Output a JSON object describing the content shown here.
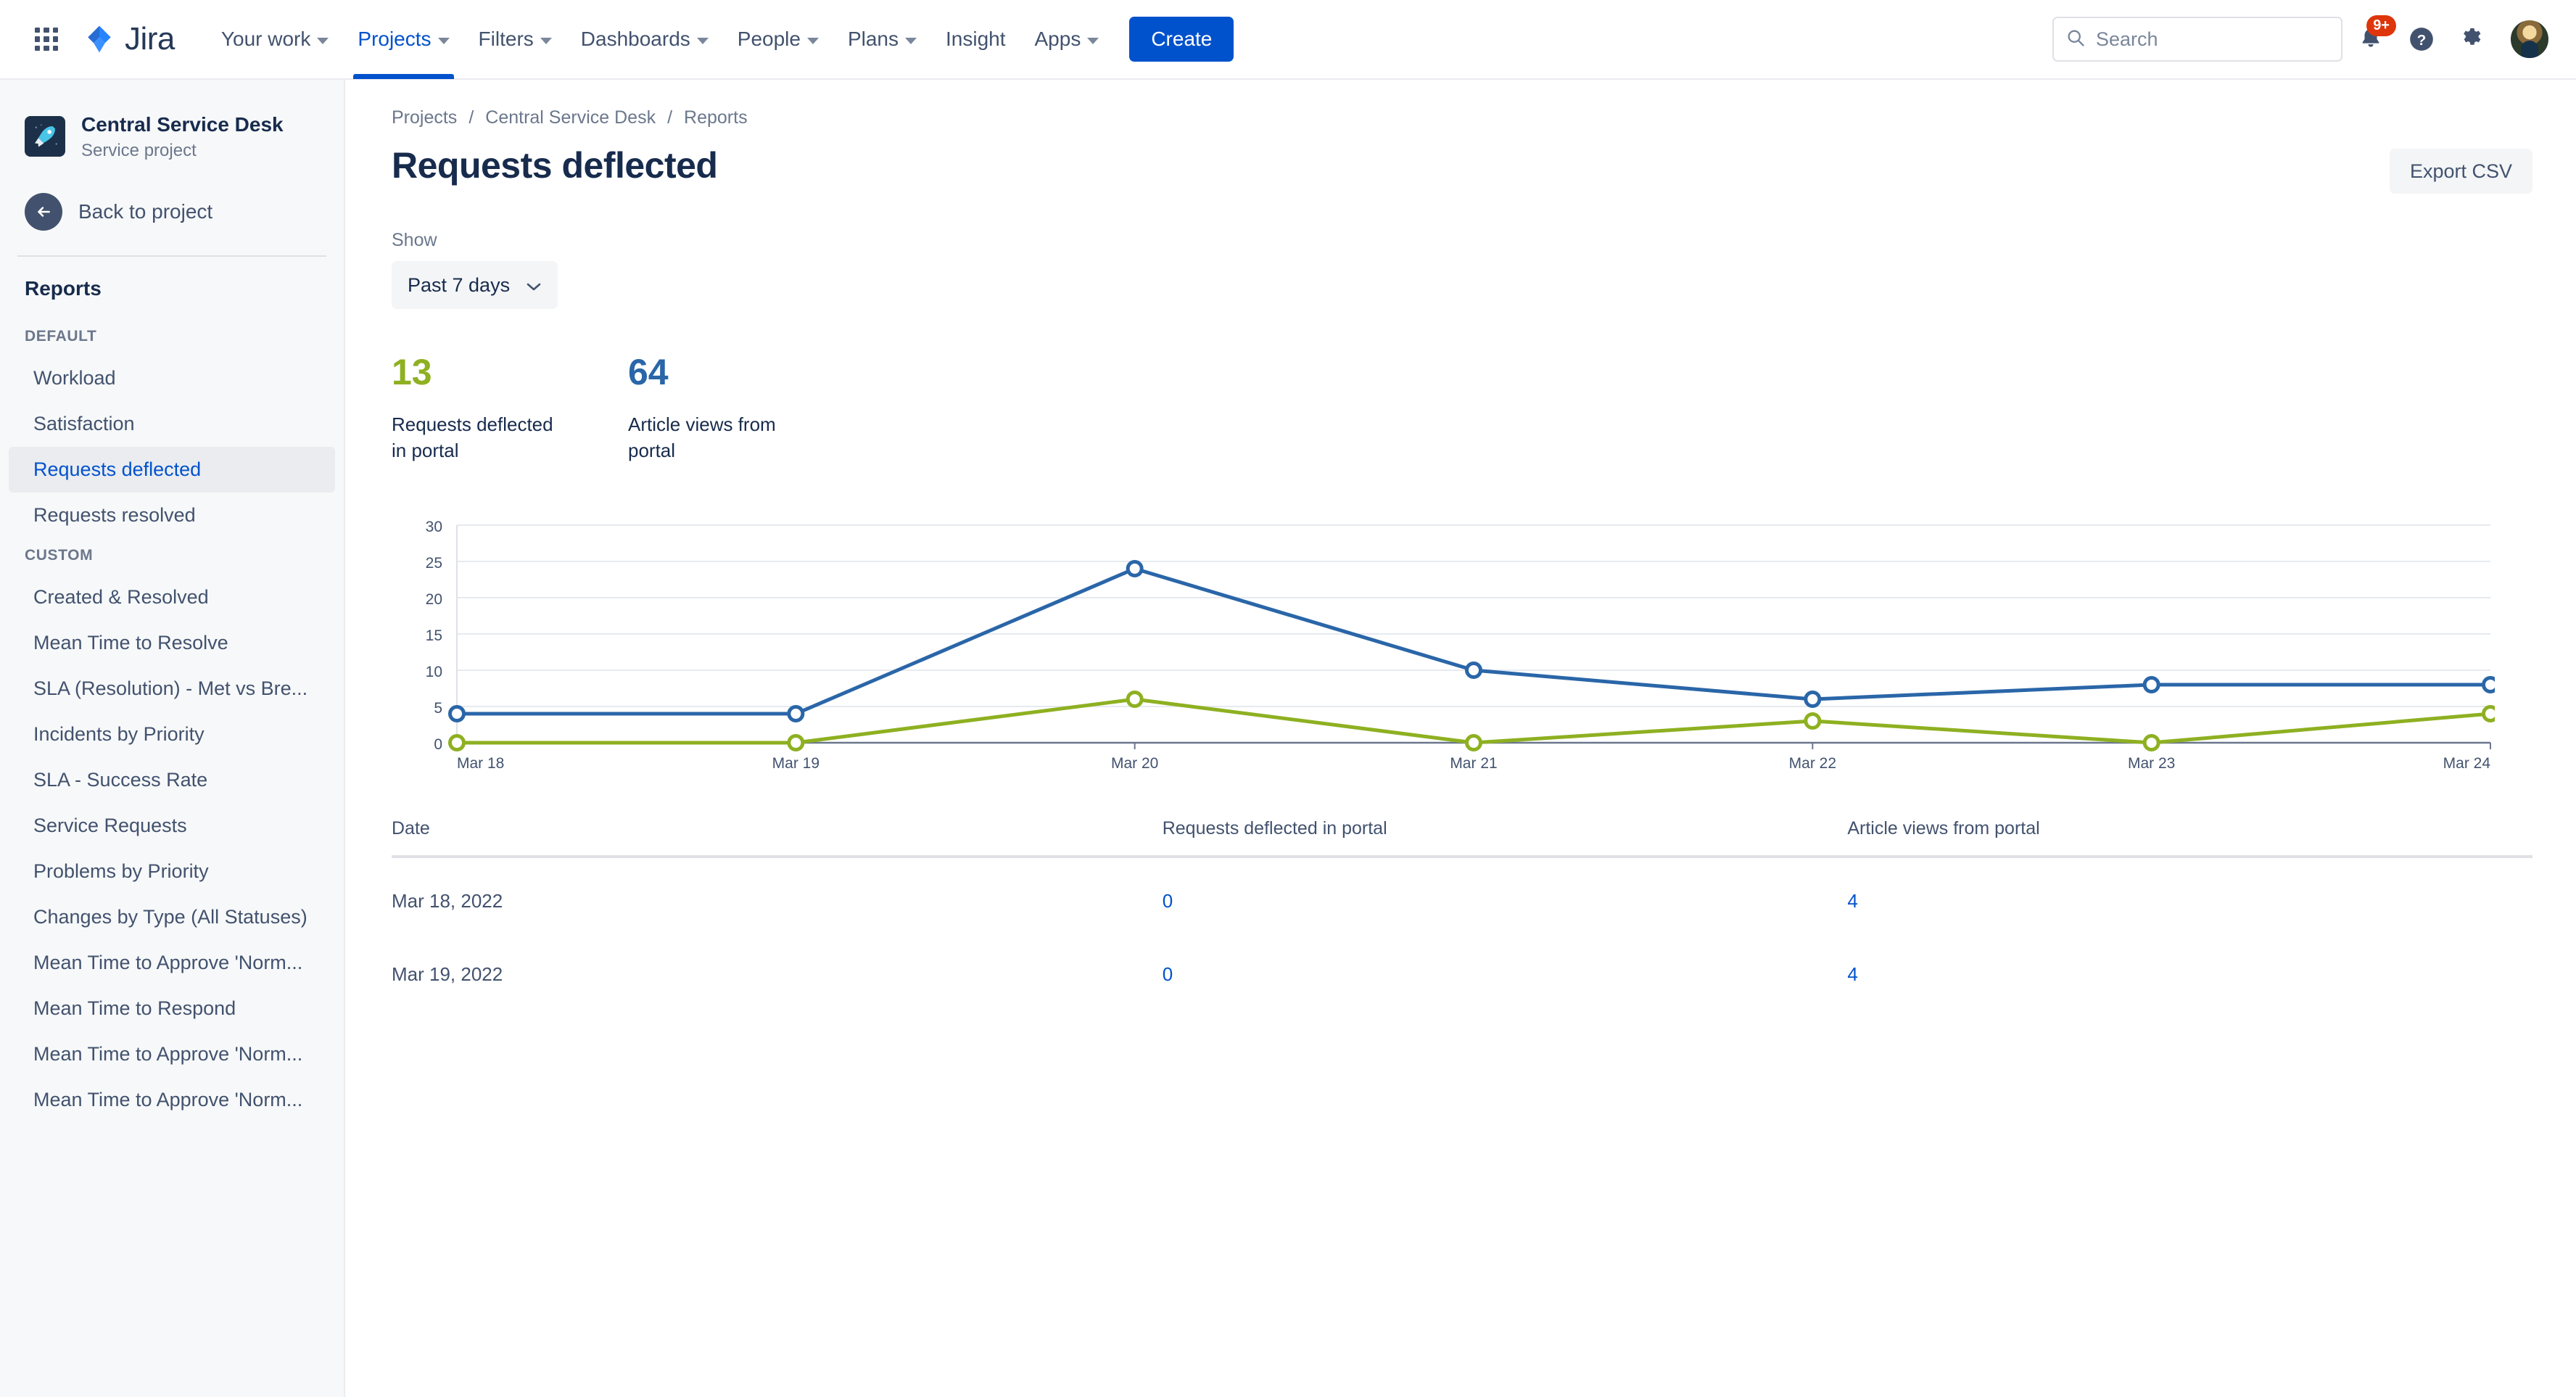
{
  "topnav": {
    "app_switcher_icon": "grid-apps-icon",
    "brand": "Jira",
    "items": [
      {
        "label": "Your work",
        "has_caret": true,
        "active": false
      },
      {
        "label": "Projects",
        "has_caret": true,
        "active": true
      },
      {
        "label": "Filters",
        "has_caret": true,
        "active": false
      },
      {
        "label": "Dashboards",
        "has_caret": true,
        "active": false
      },
      {
        "label": "People",
        "has_caret": true,
        "active": false
      },
      {
        "label": "Plans",
        "has_caret": true,
        "active": false
      },
      {
        "label": "Insight",
        "has_caret": false,
        "active": false
      },
      {
        "label": "Apps",
        "has_caret": true,
        "active": false
      }
    ],
    "create_label": "Create",
    "search": {
      "placeholder": "Search",
      "value": "",
      "icon": "search-icon"
    },
    "notifications": {
      "icon": "bell-icon",
      "badge": "9+"
    },
    "help": {
      "icon": "help-question-icon"
    },
    "settings": {
      "icon": "gear-icon"
    },
    "avatar": {
      "icon": "user-avatar"
    },
    "accent_blue": "#0052cc",
    "badge_red": "#de350b"
  },
  "sidebar": {
    "project": {
      "name": "Central Service Desk",
      "type": "Service project",
      "icon": "rocket-icon"
    },
    "back": {
      "label": "Back to project",
      "icon": "arrow-left-icon"
    },
    "section_title": "Reports",
    "groups": [
      {
        "label": "DEFAULT",
        "items": [
          {
            "label": "Workload",
            "selected": false
          },
          {
            "label": "Satisfaction",
            "selected": false
          },
          {
            "label": "Requests deflected",
            "selected": true
          },
          {
            "label": "Requests resolved",
            "selected": false
          }
        ]
      },
      {
        "label": "CUSTOM",
        "items": [
          {
            "label": "Created & Resolved",
            "selected": false
          },
          {
            "label": "Mean Time to Resolve",
            "selected": false
          },
          {
            "label": "SLA (Resolution) - Met vs Bre...",
            "selected": false
          },
          {
            "label": "Incidents by Priority",
            "selected": false
          },
          {
            "label": "SLA - Success Rate",
            "selected": false
          },
          {
            "label": "Service Requests",
            "selected": false
          },
          {
            "label": "Problems by Priority",
            "selected": false
          },
          {
            "label": "Changes by Type (All Statuses)",
            "selected": false
          },
          {
            "label": "Mean Time to Approve 'Norm...",
            "selected": false
          },
          {
            "label": "Mean Time to Respond",
            "selected": false
          },
          {
            "label": "Mean Time to Approve 'Norm...",
            "selected": false
          },
          {
            "label": "Mean Time to Approve 'Norm...",
            "selected": false
          }
        ]
      }
    ]
  },
  "main": {
    "breadcrumb": [
      "Projects",
      "Central Service Desk",
      "Reports"
    ],
    "breadcrumb_separator": "/",
    "page_title": "Requests deflected",
    "export_label": "Export CSV",
    "show_label": "Show",
    "show_value": "Past 7 days",
    "show_caret_icon": "chevron-down-icon",
    "stats": [
      {
        "value": "13",
        "label": "Requests deflected in portal",
        "color": "#8eb021"
      },
      {
        "value": "64",
        "label": "Article views from portal",
        "color": "#2a66a8"
      }
    ],
    "table": {
      "columns": [
        "Date",
        "Requests deflected in portal",
        "Article views from portal"
      ],
      "rows": [
        {
          "date": "Mar 18, 2022",
          "deflected": "0",
          "views": "4"
        },
        {
          "date": "Mar 19, 2022",
          "deflected": "0",
          "views": "4"
        }
      ]
    }
  },
  "chart_data": {
    "type": "line",
    "title": "",
    "xlabel": "",
    "ylabel": "",
    "grid": true,
    "legend": "none",
    "categories": [
      "Mar 18",
      "Mar 19",
      "Mar 20",
      "Mar 21",
      "Mar 22",
      "Mar 23",
      "Mar 24"
    ],
    "yticks": [
      0,
      5,
      10,
      15,
      20,
      25,
      30
    ],
    "ylim": [
      0,
      30
    ],
    "series": [
      {
        "name": "Article views from portal",
        "color": "#2a66a8",
        "values": [
          4,
          4,
          24,
          10,
          6,
          8,
          8
        ]
      },
      {
        "name": "Requests deflected in portal",
        "color": "#8eb021",
        "values": [
          0,
          0,
          6,
          0,
          3,
          0,
          4
        ]
      }
    ]
  }
}
